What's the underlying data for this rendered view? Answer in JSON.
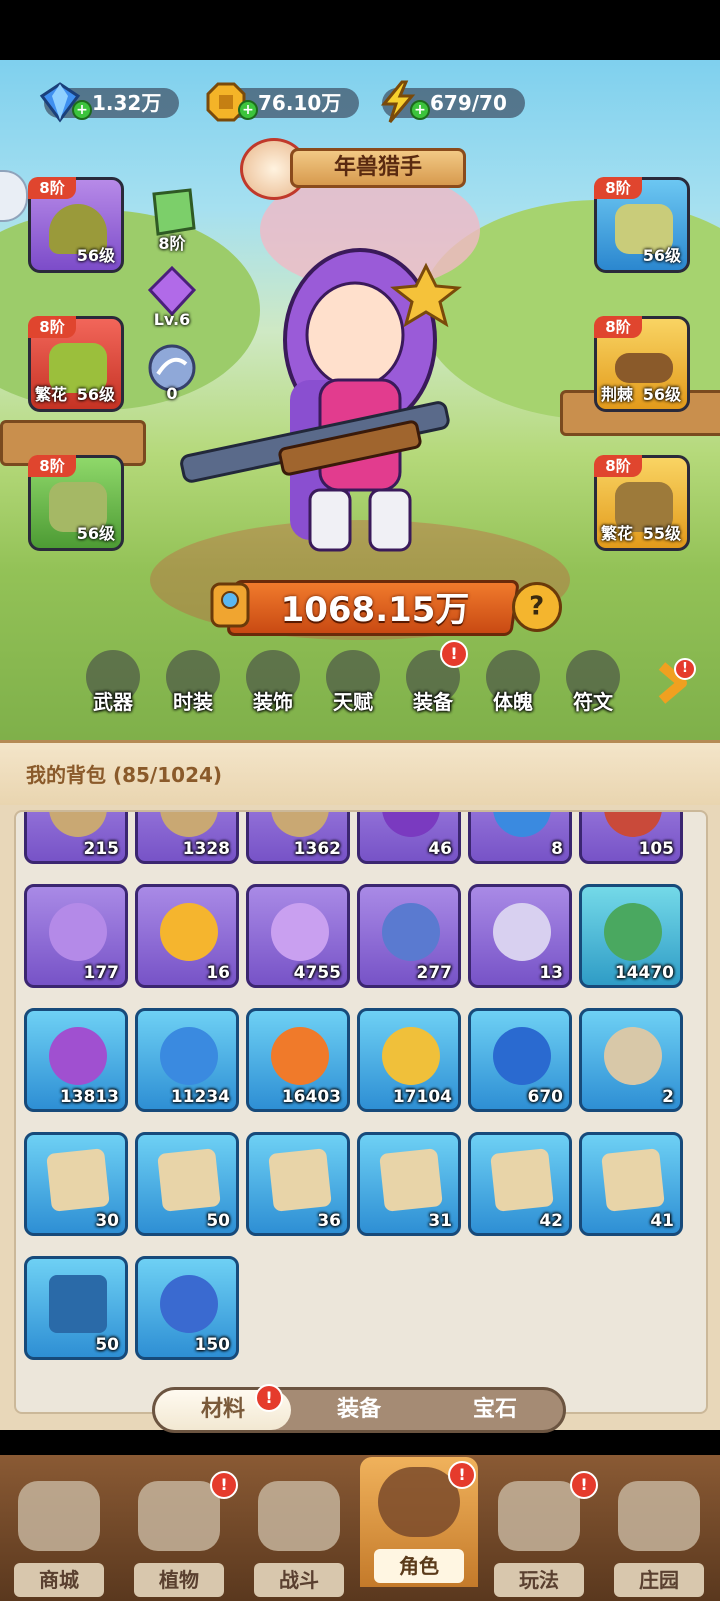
{
  "resources": {
    "diamonds": "1.32万",
    "gold": "76.10万",
    "energy": "679/70"
  },
  "title_banner": "年兽猎手",
  "equipment": {
    "hat": {
      "tier": "8阶",
      "level": "56级"
    },
    "weapon_tree": {
      "tier": "8阶",
      "affix": "繁花",
      "level": "56级"
    },
    "pants": {
      "tier": "8阶",
      "level": "56级"
    },
    "armor": {
      "tier": "8阶",
      "level": "56级"
    },
    "belt": {
      "tier": "8阶",
      "affix": "荆棘",
      "level": "56级"
    },
    "boots": {
      "tier": "8阶",
      "affix": "繁花",
      "level": "55级"
    }
  },
  "mini_slots": {
    "card": "8阶",
    "crystal": "Lv.6",
    "orb": "0"
  },
  "power": "1068.15万",
  "power_help": "?",
  "nav": [
    {
      "label": "武器"
    },
    {
      "label": "时装"
    },
    {
      "label": "装饰"
    },
    {
      "label": "天赋"
    },
    {
      "label": "装备",
      "badge": "!"
    },
    {
      "label": "体魄"
    },
    {
      "label": "符文"
    }
  ],
  "more_badge": "!",
  "backpack": {
    "title": "我的背包 (85/1024)",
    "items": [
      {
        "count": "215"
      },
      {
        "count": "1328"
      },
      {
        "count": "1362"
      },
      {
        "count": "46"
      },
      {
        "count": "8"
      },
      {
        "count": "105"
      },
      {
        "count": "177"
      },
      {
        "count": "16"
      },
      {
        "count": "4755"
      },
      {
        "count": "277"
      },
      {
        "count": "13"
      },
      {
        "count": "14470"
      },
      {
        "count": "13813"
      },
      {
        "count": "11234"
      },
      {
        "count": "16403"
      },
      {
        "count": "17104"
      },
      {
        "count": "670"
      },
      {
        "count": "2"
      },
      {
        "count": "30"
      },
      {
        "count": "50"
      },
      {
        "count": "36"
      },
      {
        "count": "31"
      },
      {
        "count": "42"
      },
      {
        "count": "41"
      },
      {
        "count": "50"
      },
      {
        "count": "150"
      }
    ]
  },
  "tabs": [
    {
      "label": "材料",
      "badge": "!"
    },
    {
      "label": "装备"
    },
    {
      "label": "宝石"
    }
  ],
  "bottom_nav": [
    {
      "label": "商城"
    },
    {
      "label": "植物",
      "badge": "!"
    },
    {
      "label": "战斗"
    },
    {
      "label": "角色",
      "badge": "!"
    },
    {
      "label": "玩法",
      "badge": "!"
    },
    {
      "label": "庄园"
    }
  ]
}
